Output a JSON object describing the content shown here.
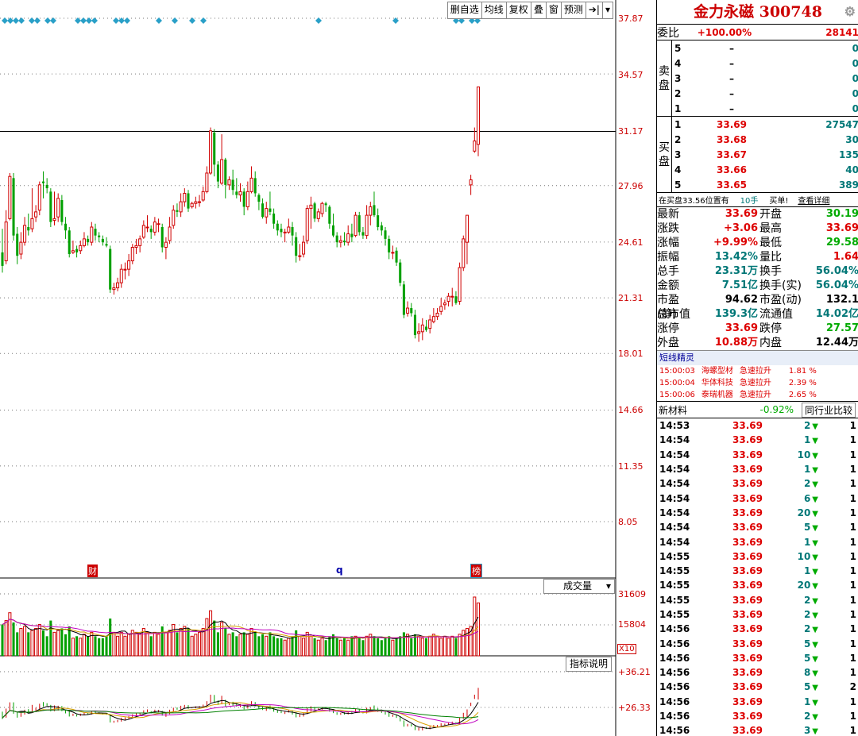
{
  "toolbar": {
    "buttons": [
      "删自选",
      "均线",
      "复权",
      "叠",
      "窗",
      "预测"
    ],
    "main_indicator": "成交量",
    "sub_indicator": "指标说明",
    "vol_scale": "X10"
  },
  "price_axis": [
    "37.87",
    "34.57",
    "31.17",
    "27.96",
    "24.61",
    "21.31",
    "18.01",
    "14.66",
    "11.35",
    "8.05"
  ],
  "volume_axis": [
    "31609",
    "15804"
  ],
  "indicator_axis": [
    "+36.21",
    "+26.33"
  ],
  "chart_markers": [
    "财",
    "q",
    "榜"
  ],
  "colors": {
    "up": "#d00000",
    "down": "#00a000",
    "line_white": "#000000",
    "line_yellow": "#d8a000",
    "line_purple": "#c000c0",
    "line_green": "#008000",
    "marker": "#2aa0c8"
  },
  "chart_data": {
    "type": "candlestick",
    "price_range": [
      8.05,
      37.87
    ],
    "candles": [
      [
        24.0,
        23.2,
        25.4,
        22.8
      ],
      [
        23.5,
        25.8,
        26.5,
        23.3
      ],
      [
        26.0,
        28.5,
        28.7,
        25.9
      ],
      [
        28.4,
        25.0,
        28.7,
        24.7
      ],
      [
        25.1,
        23.8,
        25.5,
        23.3
      ],
      [
        23.9,
        24.6,
        25.2,
        23.6
      ],
      [
        24.6,
        25.6,
        26.1,
        24.4
      ],
      [
        25.5,
        25.3,
        26.3,
        25.0
      ],
      [
        25.4,
        26.0,
        27.8,
        25.2
      ],
      [
        26.1,
        26.4,
        26.8,
        25.8
      ],
      [
        26.5,
        28.0,
        28.2,
        26.2
      ],
      [
        28.2,
        28.1,
        28.8,
        27.2
      ],
      [
        28.0,
        27.8,
        28.4,
        27.5
      ],
      [
        27.6,
        25.8,
        27.8,
        25.5
      ],
      [
        25.9,
        26.0,
        27.6,
        25.6
      ],
      [
        26.1,
        27.2,
        27.5,
        25.8
      ],
      [
        27.1,
        25.8,
        27.4,
        25.6
      ],
      [
        25.7,
        25.3,
        26.1,
        24.8
      ],
      [
        25.3,
        23.9,
        25.5,
        23.7
      ],
      [
        24.0,
        24.1,
        24.7,
        23.9
      ],
      [
        24.2,
        24.0,
        24.4,
        23.7
      ],
      [
        24.1,
        24.4,
        24.7,
        23.9
      ],
      [
        24.4,
        24.8,
        25.2,
        24.3
      ],
      [
        24.8,
        24.6,
        25.0,
        24.4
      ],
      [
        24.6,
        25.5,
        25.8,
        24.4
      ],
      [
        25.4,
        25.0,
        25.7,
        24.7
      ],
      [
        25.0,
        24.9,
        25.2,
        24.6
      ],
      [
        24.8,
        24.6,
        25.0,
        24.4
      ],
      [
        24.5,
        24.4,
        24.9,
        24.3
      ],
      [
        24.2,
        21.8,
        24.4,
        21.6
      ],
      [
        21.8,
        21.9,
        22.2,
        21.5
      ],
      [
        21.9,
        22.2,
        22.5,
        21.7
      ],
      [
        22.2,
        23.0,
        23.3,
        21.9
      ],
      [
        23.0,
        23.0,
        23.4,
        22.4
      ],
      [
        23.0,
        23.5,
        23.9,
        22.6
      ],
      [
        23.5,
        24.3,
        24.5,
        23.3
      ],
      [
        24.3,
        24.4,
        24.8,
        23.9
      ],
      [
        24.4,
        24.8,
        25.0,
        24.0
      ],
      [
        24.9,
        25.6,
        25.9,
        24.8
      ],
      [
        25.5,
        25.5,
        26.2,
        25.2
      ],
      [
        25.4,
        25.2,
        25.6,
        24.8
      ],
      [
        25.2,
        25.8,
        26.1,
        25.0
      ],
      [
        25.7,
        25.7,
        26.0,
        25.2
      ],
      [
        25.5,
        24.3,
        25.7,
        24.0
      ],
      [
        24.3,
        24.6,
        24.9,
        23.6
      ],
      [
        24.7,
        25.5,
        26.1,
        24.5
      ],
      [
        25.6,
        26.5,
        26.8,
        25.4
      ],
      [
        26.5,
        26.4,
        26.9,
        26.1
      ],
      [
        26.4,
        27.0,
        27.5,
        26.1
      ],
      [
        27.0,
        27.5,
        27.8,
        26.7
      ],
      [
        27.5,
        26.6,
        27.7,
        26.4
      ],
      [
        26.7,
        26.9,
        27.0,
        26.6
      ],
      [
        26.9,
        27.0,
        27.3,
        26.6
      ],
      [
        27.0,
        27.0,
        27.4,
        26.7
      ],
      [
        27.1,
        27.6,
        27.9,
        27.0
      ],
      [
        27.6,
        28.7,
        29.1,
        27.5
      ],
      [
        28.7,
        31.2,
        31.4,
        28.6
      ],
      [
        31.1,
        29.2,
        31.3,
        28.5
      ],
      [
        29.2,
        28.2,
        29.4,
        27.8
      ],
      [
        28.1,
        29.5,
        31.0,
        28.0
      ],
      [
        29.5,
        28.0,
        29.6,
        27.2
      ],
      [
        28.0,
        28.3,
        28.5,
        27.7
      ],
      [
        28.3,
        27.7,
        28.9,
        27.4
      ],
      [
        27.6,
        27.4,
        28.4,
        27.2
      ],
      [
        27.4,
        27.6,
        28.1,
        27.0
      ],
      [
        27.6,
        26.7,
        27.8,
        26.2
      ],
      [
        26.7,
        27.6,
        28.2,
        26.5
      ],
      [
        27.6,
        28.4,
        29.1,
        27.5
      ],
      [
        28.4,
        27.5,
        28.8,
        27.3
      ],
      [
        27.4,
        27.0,
        27.5,
        26.5
      ],
      [
        26.9,
        26.1,
        27.2,
        26.0
      ],
      [
        26.1,
        26.6,
        27.0,
        25.7
      ],
      [
        26.6,
        26.4,
        27.6,
        26.2
      ],
      [
        26.3,
        25.7,
        26.6,
        25.4
      ],
      [
        25.7,
        25.3,
        25.9,
        25.0
      ],
      [
        25.4,
        25.2,
        25.7,
        24.9
      ],
      [
        25.2,
        25.2,
        25.4,
        24.6
      ],
      [
        25.2,
        25.5,
        26.0,
        25.1
      ],
      [
        25.5,
        25.0,
        25.8,
        24.4
      ],
      [
        24.9,
        23.8,
        25.2,
        23.4
      ],
      [
        23.8,
        23.8,
        24.5,
        23.5
      ],
      [
        23.9,
        24.6,
        25.0,
        23.7
      ],
      [
        24.7,
        26.6,
        26.8,
        24.5
      ],
      [
        26.6,
        26.8,
        27.3,
        25.4
      ],
      [
        26.9,
        26.0,
        27.0,
        25.8
      ],
      [
        26.0,
        26.4,
        26.6,
        25.8
      ],
      [
        26.3,
        26.9,
        27.0,
        26.1
      ],
      [
        26.9,
        26.8,
        27.0,
        26.4
      ],
      [
        26.7,
        25.7,
        26.8,
        25.4
      ],
      [
        25.6,
        25.0,
        26.3,
        24.9
      ],
      [
        25.0,
        24.6,
        25.2,
        24.3
      ],
      [
        24.6,
        24.7,
        25.0,
        24.3
      ],
      [
        24.7,
        24.6,
        25.2,
        24.4
      ],
      [
        24.6,
        25.1,
        25.6,
        24.4
      ],
      [
        25.1,
        24.9,
        25.7,
        24.6
      ],
      [
        25.0,
        26.2,
        26.4,
        24.9
      ],
      [
        26.2,
        25.2,
        26.4,
        25.0
      ],
      [
        25.2,
        25.0,
        25.5,
        24.8
      ],
      [
        25.0,
        26.2,
        26.8,
        24.8
      ],
      [
        26.2,
        26.7,
        27.0,
        25.6
      ],
      [
        26.8,
        26.2,
        27.6,
        26.1
      ],
      [
        26.2,
        25.5,
        26.6,
        25.3
      ],
      [
        25.6,
        25.3,
        25.8,
        25.0
      ],
      [
        25.3,
        24.8,
        25.5,
        24.4
      ],
      [
        24.8,
        24.0,
        25.0,
        23.6
      ],
      [
        24.0,
        24.0,
        24.4,
        23.6
      ],
      [
        24.1,
        23.4,
        24.3,
        23.2
      ],
      [
        23.4,
        22.2,
        23.6,
        22.0
      ],
      [
        22.1,
        20.3,
        22.3,
        20.1
      ],
      [
        20.4,
        20.7,
        21.1,
        20.2
      ],
      [
        20.7,
        20.4,
        21.0,
        20.2
      ],
      [
        20.3,
        19.1,
        20.6,
        18.9
      ],
      [
        19.2,
        19.3,
        19.8,
        18.7
      ],
      [
        19.3,
        19.7,
        20.1,
        18.8
      ],
      [
        19.6,
        19.4,
        20.0,
        19.3
      ],
      [
        19.5,
        20.0,
        20.3,
        19.2
      ],
      [
        19.9,
        20.2,
        20.7,
        19.8
      ],
      [
        20.2,
        20.4,
        20.7,
        20.0
      ],
      [
        20.5,
        20.8,
        21.3,
        20.3
      ],
      [
        20.9,
        21.0,
        21.2,
        20.6
      ],
      [
        21.1,
        21.4,
        21.6,
        20.8
      ],
      [
        21.4,
        21.4,
        21.9,
        20.8
      ],
      [
        21.4,
        21.0,
        21.7,
        20.9
      ],
      [
        21.1,
        23.1,
        23.4,
        20.9
      ],
      [
        23.1,
        24.8,
        25.0,
        22.9
      ],
      [
        24.6,
        26.2,
        26.2,
        23.3
      ],
      [
        28.0,
        28.3,
        28.6,
        27.4
      ],
      [
        30.0,
        30.6,
        31.4,
        29.9
      ],
      [
        30.4,
        33.8,
        33.8,
        29.7
      ]
    ],
    "volume": [
      16,
      18,
      22,
      17,
      12,
      14,
      15,
      12,
      13,
      14,
      16,
      13,
      10,
      18,
      12,
      13,
      14,
      11,
      15,
      9,
      10,
      9,
      11,
      10,
      12,
      10,
      9,
      9,
      10,
      19,
      12,
      10,
      12,
      10,
      11,
      13,
      12,
      11,
      14,
      12,
      10,
      12,
      11,
      15,
      12,
      13,
      16,
      12,
      14,
      15,
      14,
      10,
      11,
      12,
      14,
      19,
      23,
      18,
      12,
      17,
      14,
      11,
      12,
      10,
      11,
      12,
      11,
      14,
      12,
      10,
      11,
      10,
      12,
      10,
      9,
      9,
      8,
      9,
      10,
      13,
      10,
      9,
      12,
      10,
      9,
      8,
      9,
      8,
      10,
      11,
      9,
      8,
      9,
      8,
      10,
      10,
      9,
      8,
      10,
      11,
      10,
      9,
      8,
      9,
      10,
      8,
      9,
      10,
      12,
      11,
      9,
      11,
      10,
      9,
      9,
      10,
      11,
      10,
      9,
      10,
      9,
      10,
      9,
      11,
      13,
      14,
      15,
      30,
      27
    ],
    "quote": {
      "code": "300748",
      "last": "33.69",
      "change": "+3.06",
      "pct": "+9.99%"
    }
  },
  "panel": {
    "title": "金力永磁 300748",
    "gear": "⚙",
    "weibi_label": "委比",
    "weibi_value": "+100.00%",
    "weibi_diff": "28141",
    "sell_side_label": [
      "卖",
      "盘"
    ],
    "buy_side_label": [
      "买",
      "盘"
    ],
    "sell": [
      {
        "level": "5",
        "price": "–",
        "vol": "0"
      },
      {
        "level": "4",
        "price": "–",
        "vol": "0"
      },
      {
        "level": "3",
        "price": "–",
        "vol": "0"
      },
      {
        "level": "2",
        "price": "–",
        "vol": "0"
      },
      {
        "level": "1",
        "price": "–",
        "vol": "0"
      }
    ],
    "buy": [
      {
        "level": "1",
        "price": "33.69",
        "vol": "27547"
      },
      {
        "level": "2",
        "price": "33.68",
        "vol": "30"
      },
      {
        "level": "3",
        "price": "33.67",
        "vol": "135"
      },
      {
        "level": "4",
        "price": "33.66",
        "vol": "40"
      },
      {
        "level": "5",
        "price": "33.65",
        "vol": "389"
      }
    ],
    "position_note": "在买盘33.56位置有",
    "position_qty": "10手",
    "position_tag": "买单!",
    "detail_link": "查看详细",
    "stats": [
      {
        "l1": "最新",
        "v1": "33.69",
        "c1": "r",
        "l2": "开盘",
        "v2": "30.19",
        "c2": "g"
      },
      {
        "l1": "涨跌",
        "v1": "+3.06",
        "c1": "r",
        "l2": "最高",
        "v2": "33.69",
        "c2": "r"
      },
      {
        "l1": "涨幅",
        "v1": "+9.99%",
        "c1": "r",
        "l2": "最低",
        "v2": "29.58",
        "c2": "g"
      },
      {
        "l1": "振幅",
        "v1": "13.42%",
        "c1": "t",
        "l2": "量比",
        "v2": "1.64",
        "c2": "r"
      },
      {
        "l1": "总手",
        "v1": "23.31万",
        "c1": "t",
        "l2": "换手",
        "v2": "56.04%",
        "c2": "t"
      },
      {
        "l1": "金额",
        "v1": "7.51亿",
        "c1": "t",
        "l2": "换手(实)",
        "v2": "56.04%",
        "c2": "t"
      },
      {
        "l1": "市盈(静)",
        "v1": "94.62",
        "c1": "k",
        "l2": "市盈(动)",
        "v2": "132.1",
        "c2": "k"
      },
      {
        "l1": "总市值",
        "v1": "139.3亿",
        "c1": "t",
        "l2": "流通值",
        "v2": "14.02亿",
        "c2": "t"
      },
      {
        "l1": "涨停",
        "v1": "33.69",
        "c1": "r",
        "l2": "跌停",
        "v2": "27.57",
        "c2": "g"
      },
      {
        "l1": "外盘",
        "v1": "10.88万",
        "c1": "r",
        "l2": "内盘",
        "v2": "12.44万",
        "c2": "k"
      }
    ],
    "short_title": "短线精灵",
    "alerts": [
      {
        "time": "15:00:03",
        "name": "海螺型材",
        "event": "急速拉升",
        "pct": "1.81 %"
      },
      {
        "time": "15:00:04",
        "name": "华体科技",
        "event": "急速拉升",
        "pct": "2.39 %"
      },
      {
        "time": "15:00:06",
        "name": "泰瑞机器",
        "event": "急速拉升",
        "pct": "2.65 %"
      }
    ],
    "sector_name": "新材料",
    "sector_pct": "-0.92%",
    "compare_btn": "同行业比较",
    "ticks": [
      {
        "t": "14:53",
        "p": "33.69",
        "v": "2",
        "n": "1"
      },
      {
        "t": "14:54",
        "p": "33.69",
        "v": "1",
        "n": "1"
      },
      {
        "t": "14:54",
        "p": "33.69",
        "v": "10",
        "n": "1"
      },
      {
        "t": "14:54",
        "p": "33.69",
        "v": "1",
        "n": "1"
      },
      {
        "t": "14:54",
        "p": "33.69",
        "v": "2",
        "n": "1"
      },
      {
        "t": "14:54",
        "p": "33.69",
        "v": "6",
        "n": "1"
      },
      {
        "t": "14:54",
        "p": "33.69",
        "v": "20",
        "n": "1"
      },
      {
        "t": "14:54",
        "p": "33.69",
        "v": "5",
        "n": "1"
      },
      {
        "t": "14:54",
        "p": "33.69",
        "v": "1",
        "n": "1"
      },
      {
        "t": "14:55",
        "p": "33.69",
        "v": "10",
        "n": "1"
      },
      {
        "t": "14:55",
        "p": "33.69",
        "v": "1",
        "n": "1"
      },
      {
        "t": "14:55",
        "p": "33.69",
        "v": "20",
        "n": "1"
      },
      {
        "t": "14:55",
        "p": "33.69",
        "v": "2",
        "n": "1"
      },
      {
        "t": "14:55",
        "p": "33.69",
        "v": "2",
        "n": "1"
      },
      {
        "t": "14:56",
        "p": "33.69",
        "v": "2",
        "n": "1"
      },
      {
        "t": "14:56",
        "p": "33.69",
        "v": "5",
        "n": "1"
      },
      {
        "t": "14:56",
        "p": "33.69",
        "v": "5",
        "n": "1"
      },
      {
        "t": "14:56",
        "p": "33.69",
        "v": "8",
        "n": "1"
      },
      {
        "t": "14:56",
        "p": "33.69",
        "v": "5",
        "n": "2"
      },
      {
        "t": "14:56",
        "p": "33.69",
        "v": "1",
        "n": "1"
      },
      {
        "t": "14:56",
        "p": "33.69",
        "v": "2",
        "n": "1"
      },
      {
        "t": "14:56",
        "p": "33.69",
        "v": "3",
        "n": "1"
      }
    ]
  }
}
